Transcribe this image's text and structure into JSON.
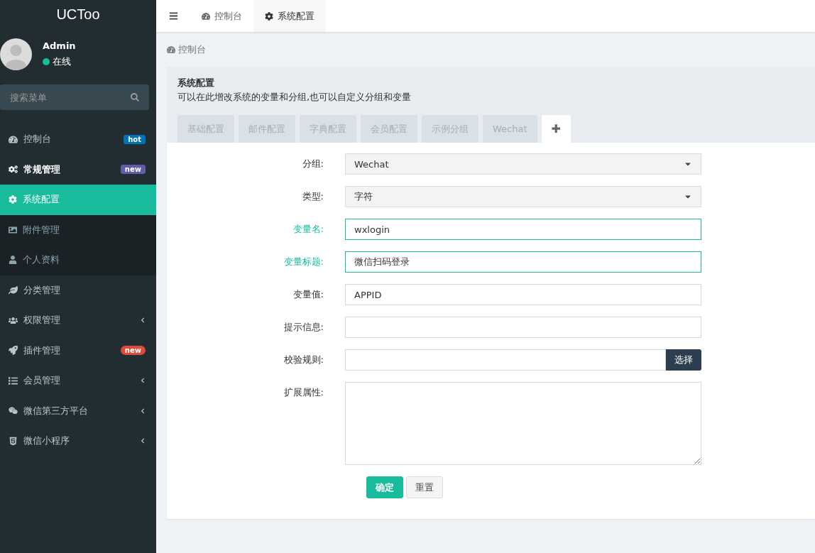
{
  "brand": "UCToo",
  "user": {
    "name": "Admin",
    "status": "在线",
    "online": true
  },
  "search": {
    "placeholder": "搜索菜单"
  },
  "menu": [
    {
      "label": "控制台",
      "badge": "hot",
      "color": "#0073b7",
      "selected": false,
      "has_submenu": false
    },
    {
      "label": "常规管理",
      "badge": "new",
      "color": "#605ca8",
      "selected": false,
      "has_submenu": false,
      "expanded": true,
      "children": [
        {
          "label": "系统配置",
          "selected": true
        },
        {
          "label": "附件管理",
          "selected": false
        },
        {
          "label": "个人资料",
          "selected": false
        }
      ]
    },
    {
      "label": "分类管理",
      "selected": false,
      "has_submenu": false
    },
    {
      "label": "权限管理",
      "selected": false,
      "has_submenu": true
    },
    {
      "label": "插件管理",
      "badge": "new",
      "color": "#dd4b39",
      "selected": false,
      "has_submenu": false
    },
    {
      "label": "会员管理",
      "selected": false,
      "has_submenu": true
    },
    {
      "label": "微信第三方平台",
      "selected": false,
      "has_submenu": true
    },
    {
      "label": "微信小程序",
      "selected": false,
      "has_submenu": true
    }
  ],
  "top_tabs": [
    {
      "label": "控制台",
      "selected": false
    },
    {
      "label": "系统配置",
      "selected": true
    }
  ],
  "breadcrumb": "控制台",
  "panel": {
    "title": "系统配置",
    "description": "可以在此增改系统的变量和分组,也可以自定义分组和变量"
  },
  "group_tabs": [
    {
      "label": "基础配置",
      "selected": false
    },
    {
      "label": "邮件配置",
      "selected": false
    },
    {
      "label": "字典配置",
      "selected": false
    },
    {
      "label": "会员配置",
      "selected": false
    },
    {
      "label": "示例分组",
      "selected": false
    },
    {
      "label": "Wechat",
      "selected": false
    },
    {
      "label": "✚",
      "selected": true
    }
  ],
  "form": [
    {
      "kind": "select",
      "label": "分组:",
      "value": "Wechat",
      "valid": false
    },
    {
      "kind": "select",
      "label": "类型:",
      "value": "字符",
      "valid": false
    },
    {
      "kind": "input",
      "label": "变量名:",
      "value": "wxlogin",
      "valid": true
    },
    {
      "kind": "input",
      "label": "变量标题:",
      "value": "微信扫码登录",
      "valid": true
    },
    {
      "kind": "input",
      "label": "变量值:",
      "value": "APPID",
      "valid": false
    },
    {
      "kind": "input",
      "label": "提示信息:",
      "valid": false
    },
    {
      "kind": "input_button",
      "label": "校验规则:",
      "button": "选择",
      "valid": false
    },
    {
      "kind": "textarea",
      "label": "扩展属性:",
      "valid": false
    }
  ],
  "buttons": [
    {
      "label": "确定",
      "primary": true
    },
    {
      "label": "重置",
      "primary": false
    }
  ]
}
